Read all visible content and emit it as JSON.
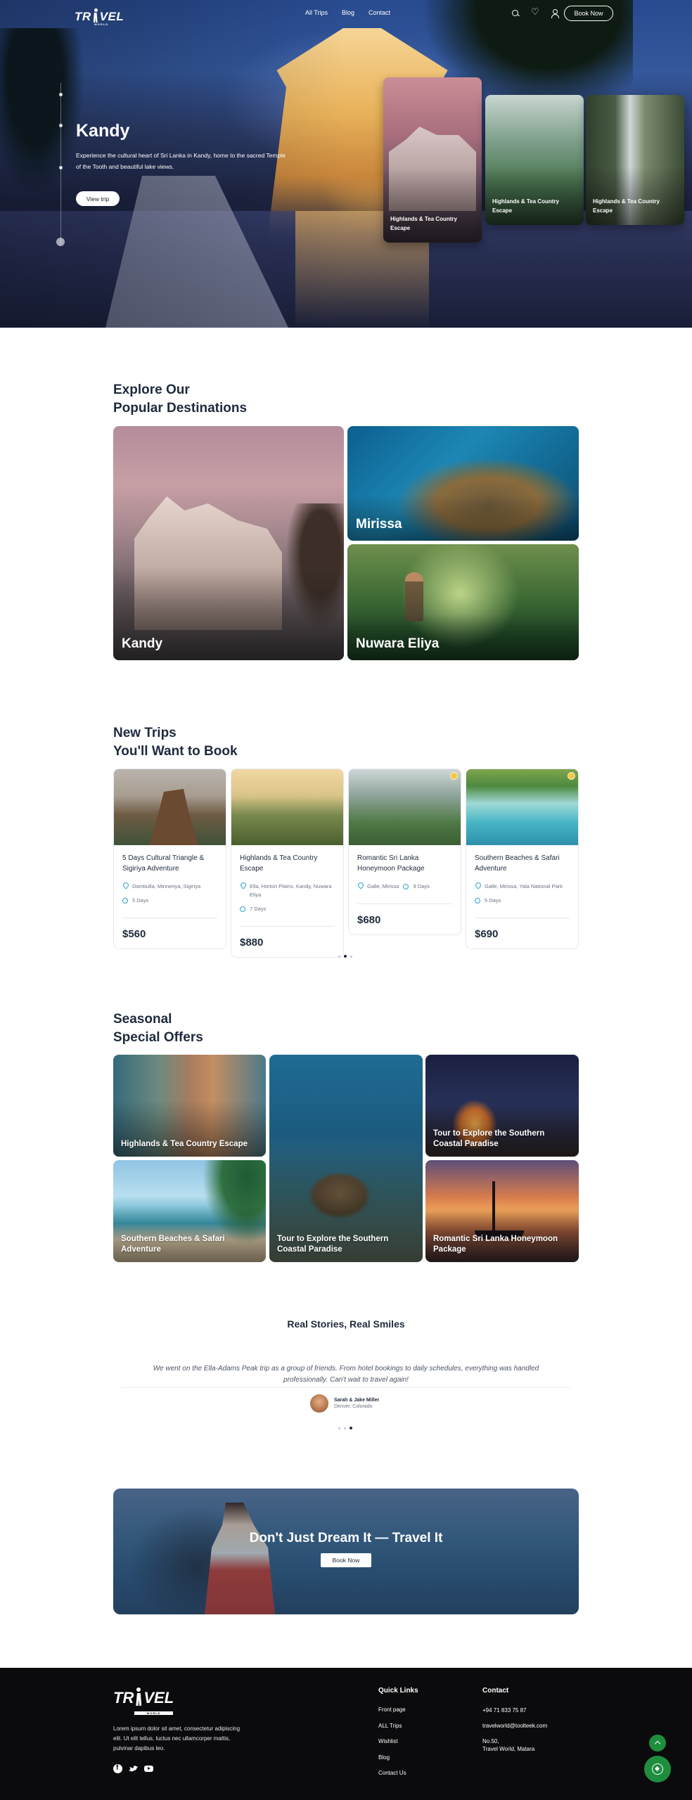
{
  "nav": {
    "logo_text": "TRAVEL",
    "logo_sub": "WORLD",
    "links": [
      "All Trips",
      "Blog",
      "Contact"
    ],
    "book_label": "Book Now"
  },
  "hero": {
    "title": "Kandy",
    "description": "Experience the cultural heart of Sri Lanka in Kandy, home to the sacred Temple of the Tooth and beautiful lake views.",
    "button": "View trip",
    "cards": [
      {
        "label": "Highlands & Tea Country Escape"
      },
      {
        "label": "Highlands & Tea Country Escape"
      },
      {
        "label": "Highlands & Tea Country Escape"
      }
    ]
  },
  "destinations": {
    "title_line1": "Explore Our",
    "title_line2": "Popular Destinations",
    "items": [
      "Kandy",
      "Mirissa",
      "Nuwara Eliya"
    ]
  },
  "trips": {
    "title_line1": "New Trips",
    "title_line2": "You'll Want to Book",
    "items": [
      {
        "title": "5 Days Cultural Triangle & Sigiriya Adventure",
        "location": "Dambulla, Minneriya, Sigiriya",
        "duration": "5 Days",
        "price": "$560"
      },
      {
        "title": "Highlands & Tea Country Escape",
        "location": "Ella, Horton Plains, Kandy, Nuwara Eliya",
        "duration": "7 Days",
        "price": "$880"
      },
      {
        "title": "Romantic Sri Lanka Honeymoon Package",
        "location": "Galle, Mirissa",
        "duration": "9 Days",
        "price": "$680"
      },
      {
        "title": "Southern Beaches & Safari Adventure",
        "location": "Galle, Mirissa, Yala National Park",
        "duration": "5 Days",
        "price": "$690"
      }
    ]
  },
  "offers": {
    "title_line1": "Seasonal",
    "title_line2": "Special Offers",
    "items": [
      "Highlands & Tea Country Escape",
      "Tour to Explore the Southern Coastal Paradise",
      "Tour to Explore the Southern Coastal Paradise",
      "Southern Beaches & Safari Adventure",
      "Romantic Sri Lanka Honeymoon Package"
    ]
  },
  "testimonials": {
    "title": "Real Stories, Real Smiles",
    "quote": "We went on the Ella-Adams Peak trip as a group of friends. From hotel bookings to daily schedules, everything was handled professionally. Can't wait to travel again!",
    "author": "Sarah & Jake Miller",
    "location": "Denver, Colorado"
  },
  "cta": {
    "title": "Don't Just Dream It — Travel It",
    "button": "Book Now"
  },
  "footer": {
    "description": "Lorem ipsum dolor sit amet, consectetur adipiscing elit. Ut elit tellus, luctus nec ullamcorper mattis, pulvinar dapibus leo.",
    "quick_links_title": "Quick Links",
    "quick_links": [
      "Front page",
      "ALL Trips",
      "Wishlist",
      "Blog",
      "Contact Us"
    ],
    "contact_title": "Contact",
    "phone": "+94 71 833 75 87",
    "email": "travelworld@toolteek.com",
    "address_line1": "No.50,",
    "address_line2": "Travel World, Matara"
  },
  "colors": {
    "accent": "#1e8e3e",
    "text": "#1f2a3d",
    "footer_bg": "#0b0b0d",
    "icon_blue": "#2aa3d9"
  }
}
